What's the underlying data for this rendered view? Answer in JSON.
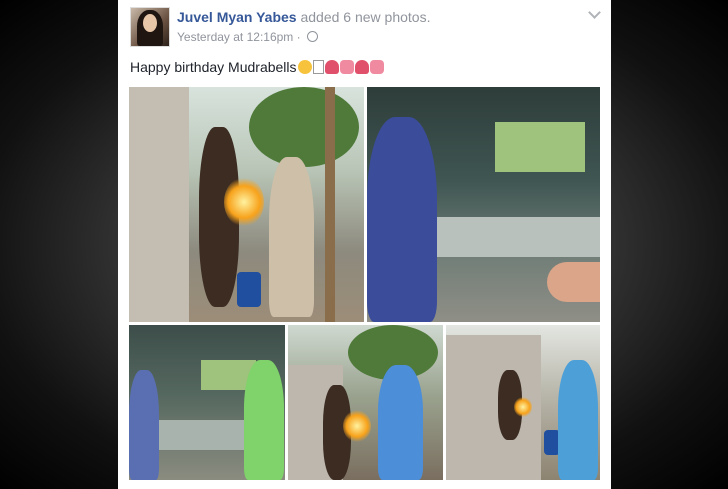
{
  "post": {
    "author": "Juvel Myan Yabes",
    "action": "added 6 new photos.",
    "timestamp": "Yesterday at 12:16pm",
    "separator": "·",
    "text": "Happy birthday Mudrabells"
  },
  "icons": {
    "options": "chevron-down-icon",
    "privacy": "globe-icon"
  },
  "photos": [
    {
      "name": "photo-1"
    },
    {
      "name": "photo-2"
    },
    {
      "name": "photo-3"
    },
    {
      "name": "photo-4"
    },
    {
      "name": "photo-5"
    }
  ],
  "colors": {
    "author_link": "#365899",
    "meta_text": "#90949c",
    "body_text": "#1d2129"
  }
}
